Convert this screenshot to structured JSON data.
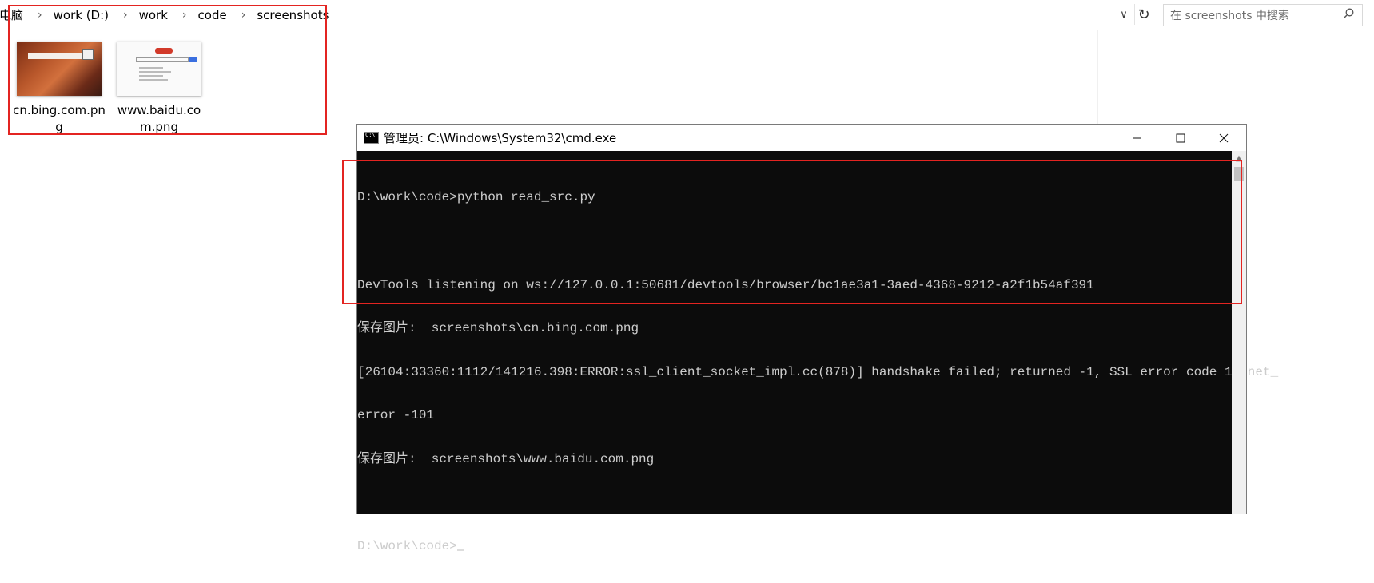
{
  "explorer": {
    "breadcrumbs": [
      "电脑",
      "work (D:)",
      "work",
      "code",
      "screenshots"
    ],
    "search_placeholder": "在 screenshots 中搜索",
    "files": [
      {
        "name": "cn.bing.com.png",
        "label_line1": "cn.bing.com.pn",
        "label_line2": "g"
      },
      {
        "name": "www.baidu.com.png",
        "label_line1": "www.baidu.co",
        "label_line2": "m.png"
      }
    ]
  },
  "cmd": {
    "title": "管理员: C:\\Windows\\System32\\cmd.exe",
    "lines": [
      "D:\\work\\code>python read_src.py",
      "",
      "DevTools listening on ws://127.0.0.1:50681/devtools/browser/bc1ae3a1-3aed-4368-9212-a2f1b54af391",
      "保存图片:  screenshots\\cn.bing.com.png",
      "[26104:33360:1112/141216.398:ERROR:ssl_client_socket_impl.cc(878)] handshake failed; returned -1, SSL error code 1, net_",
      "error -101",
      "保存图片:  screenshots\\www.baidu.com.png",
      "",
      "D:\\work\\code>"
    ]
  },
  "colors": {
    "annotation": "#e32421",
    "console_bg": "#0c0c0c",
    "console_text": "#cccccc"
  }
}
